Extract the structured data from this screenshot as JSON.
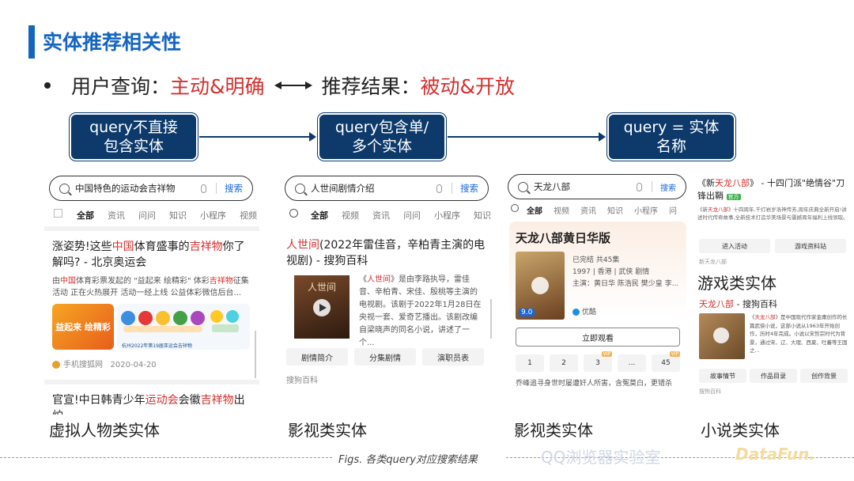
{
  "slide": {
    "title": "实体推荐相关性",
    "bullet": {
      "part1": "用户查询：",
      "part1_red": "主动&明确",
      "part2": "推荐结果：",
      "part2_red": "被动&开放"
    },
    "flow": [
      {
        "line1": "query不直接",
        "line2": "包含实体"
      },
      {
        "line1": "query包含单/",
        "line2": "多个实体"
      },
      {
        "line1": "query = 实体",
        "line2": "名称"
      }
    ],
    "captions": [
      "虚拟人物类实体",
      "影视类实体",
      "影视类实体",
      "小说类实体"
    ],
    "fig_caption": "Figs. 各类query对应搜索结果",
    "watermark1": "QQ浏览器实验室",
    "watermark2": "DataFun."
  },
  "search_label": "搜索",
  "panel1": {
    "query": "中国特色的运动会吉祥物",
    "tabs": [
      "全部",
      "资讯",
      "问问",
      "知识",
      "小程序",
      "视频"
    ],
    "result_title_a": "涨姿势!这些",
    "result_title_red1": "中国",
    "result_title_b": "体育盛事的",
    "result_title_red2": "吉祥物",
    "result_title_c": "你了解吗? - 北京奥运会",
    "snippet_a": "由",
    "snippet_red1": "中国",
    "snippet_b": "体育彩票发起的 \"益起来 绘精彩\" 体彩",
    "snippet_red2": "吉祥物",
    "snippet_c": "征集活动 正在火热展开 活动一经上线 公益体彩微信后台...",
    "img_text1": "益起来 绘精彩",
    "img_text2": "杭州2022年第19届亚运会吉祥物",
    "source": "手机搜狐网",
    "date": "2020-04-20",
    "next_title_a": "官宣!中日韩青少年",
    "next_title_red1": "运动会",
    "next_title_b": "会徽",
    "next_title_red2": "吉祥物",
    "next_title_c": "出炉"
  },
  "panel2": {
    "query": "人世间剧情介绍",
    "tabs": [
      "全部",
      "视频",
      "资讯",
      "问问",
      "小程序",
      "知识"
    ],
    "title_red": "人世间",
    "title_rest": "(2022年雷佳音，辛柏青主演的电视剧) - 搜狗百科",
    "poster_text": "人世间",
    "snippet_a": "《",
    "snippet_red": "人世间",
    "snippet_b": "》是由李路执导，雷佳音、辛柏青、宋佳、殷桃等主演的电视剧。该剧于2022年1月28日在央视一套、爱奇艺播出。该剧改编自梁晓声的同名小说，讲述了一个...",
    "buttons": [
      "剧情简介",
      "分集剧情",
      "演职员表"
    ],
    "source": "搜狗百科"
  },
  "panel3": {
    "query": "天龙八部",
    "tabs": [
      "全部",
      "视频",
      "资讯",
      "知识",
      "小程序",
      "问"
    ],
    "card_title": "天龙八部黄日华版",
    "status": "已完结 共45集",
    "meta": "1997 | 香港 | 武侠 剧情",
    "cast": "主演：黄日华 陈浩民 樊少皇 李...",
    "score": "9.0",
    "platform": "优酷",
    "watch_btn": "立即观看",
    "episodes": [
      "1",
      "2",
      "3",
      "...",
      "45"
    ],
    "vip": "VIP",
    "synopsis": "乔峰追寻身世时屡遭奸人所害，含冤莫白，更错杀"
  },
  "panel4": {
    "top_title_a": "《新",
    "top_title_red": "天龙八部",
    "top_title_b": "》 - 十四门派\"绝情谷\"刀锋出鞘",
    "top_badge": "官方",
    "top_snippet_a": "《新",
    "top_snippet_red": "天龙八部",
    "top_snippet_b": "》十四周年,千灯岩岁洛神传芳,周年庆典全新开启!讲述时代传奇故事,全新技术打造华美场景与震撼周年福利上线领取。",
    "top_buttons": [
      "进入活动",
      "游戏资料站"
    ],
    "top_source": "新天龙八部",
    "game_label": "游戏类实体",
    "novel_title_red": "天龙八部",
    "novel_title_rest": " - 搜狗百科",
    "novel_snippet_a": "《",
    "novel_snippet_red": "天龙八部",
    "novel_snippet_b": "》是中国现代作家金庸创作的长篇武侠小说，这部小说从1963年开始创作，历时4年完成。小说以宋哲宗时代为背景，通过宋、辽、大理、西夏、吐蕃等王国之...",
    "novel_buttons": [
      "故事情节",
      "作品目录",
      "创作背景"
    ],
    "novel_source": "搜狗百科"
  },
  "colors": {
    "accent_blue": "#1565c0",
    "dark_navy": "#0d3a6b",
    "highlight_red": "#d32f2f",
    "link_blue": "#1a66d8"
  }
}
